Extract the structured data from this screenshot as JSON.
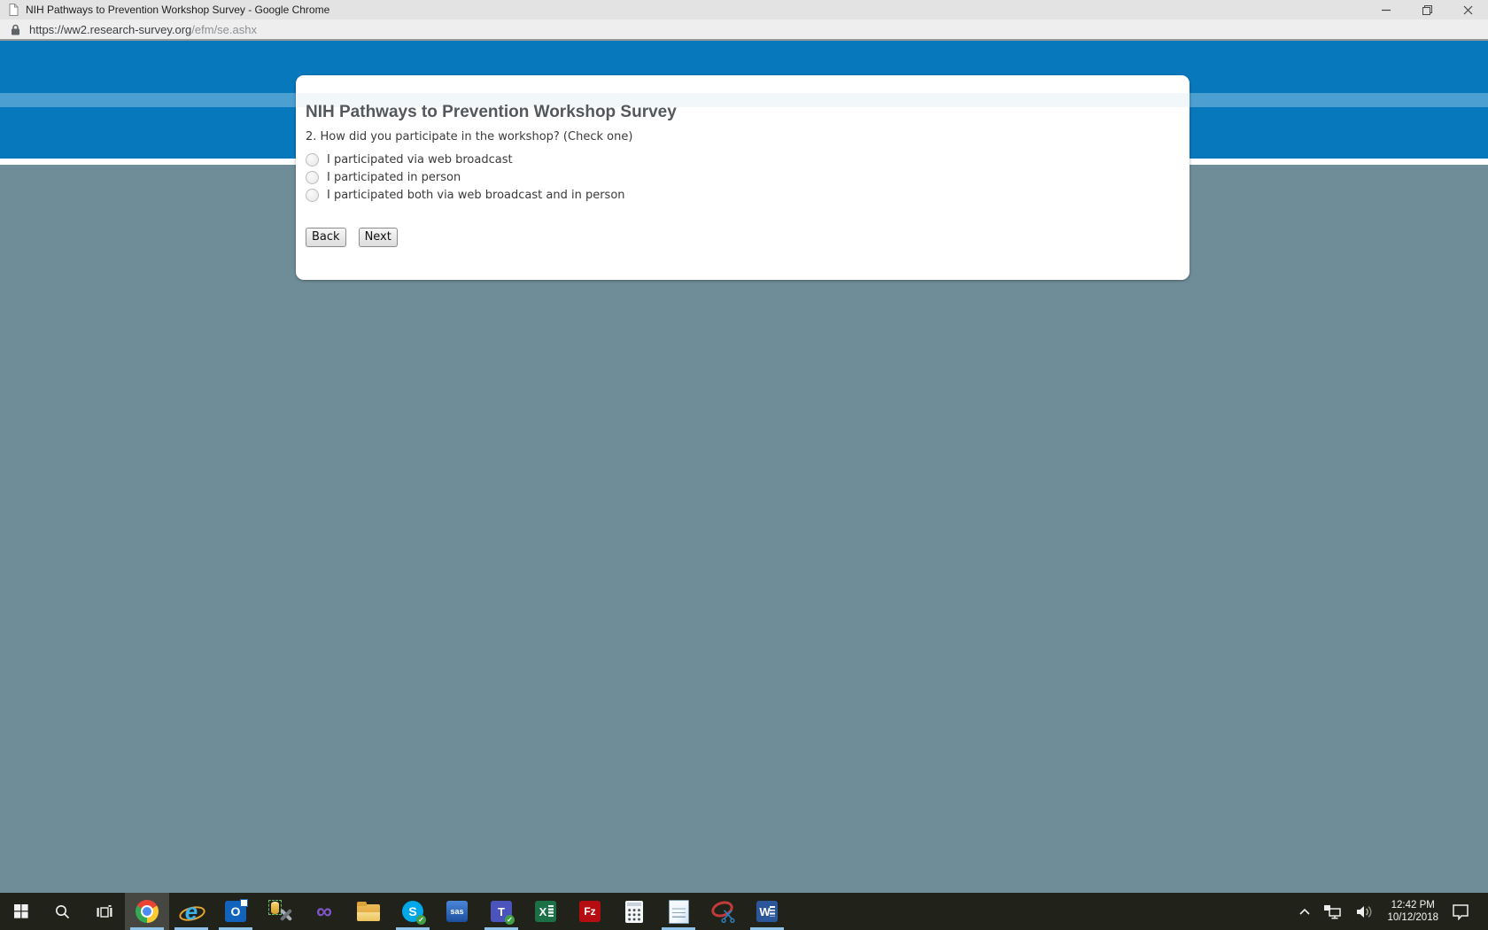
{
  "window": {
    "title": "NIH Pathways to Prevention Workshop Survey - Google Chrome",
    "url_secure": "https://ww2.research-survey.org",
    "url_path": "/efm/se.ashx"
  },
  "survey": {
    "title": "NIH Pathways to Prevention Workshop Survey",
    "question": "2. How did you participate in the workshop? (Check one)",
    "options": [
      "I participated via web broadcast",
      "I participated in person",
      "I participated both via web broadcast and in person"
    ],
    "back_label": "Back",
    "next_label": "Next"
  },
  "taskbar": {
    "items": [
      {
        "name": "chrome",
        "active": true,
        "underlined": true
      },
      {
        "name": "internet-explorer",
        "glyph": "e",
        "underlined": true
      },
      {
        "name": "outlook",
        "glyph": "O",
        "underlined": true
      },
      {
        "name": "ssms"
      },
      {
        "name": "visual-studio"
      },
      {
        "name": "file-explorer"
      },
      {
        "name": "skype",
        "glyph": "S",
        "underlined": true
      },
      {
        "name": "sas",
        "glyph": "sas"
      },
      {
        "name": "teams",
        "glyph": "T",
        "underlined": true
      },
      {
        "name": "excel",
        "glyph": "X"
      },
      {
        "name": "filezilla",
        "glyph": "Fz"
      },
      {
        "name": "calculator"
      },
      {
        "name": "notepad",
        "underlined": true
      },
      {
        "name": "snipping-tool"
      },
      {
        "name": "word",
        "glyph": "W",
        "underlined": true
      }
    ],
    "tray": {
      "time": "12:42 PM",
      "date": "10/12/2018"
    }
  },
  "colors": {
    "band_blue": "#0878bd",
    "band_light": "#4b9fd1",
    "page_gray": "#6f8d99",
    "taskbar_bg": "#21221a",
    "underline_blue": "#8fc3ea"
  }
}
